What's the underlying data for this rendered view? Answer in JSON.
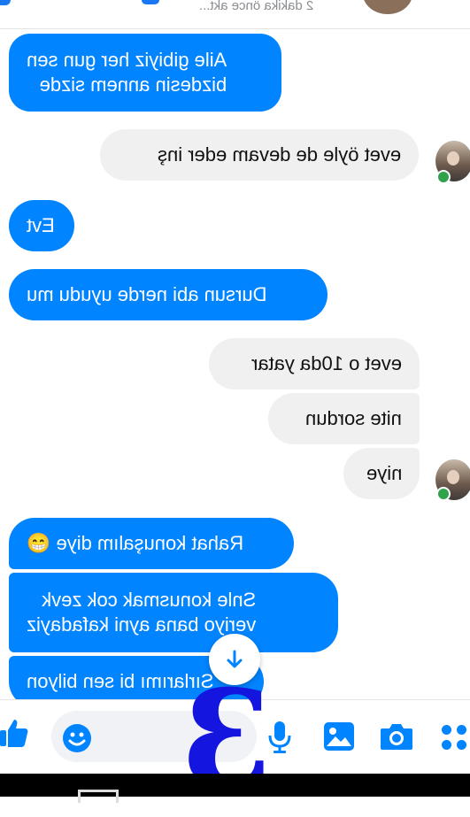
{
  "header": {
    "status_text": "2 dakika önce akt...",
    "colors": {
      "accent": "#1877f2"
    }
  },
  "messages": [
    {
      "side": "received",
      "text": "Aile gibiyiz her gun sen\nbizdesin annem sizde"
    },
    {
      "side": "sent",
      "text": "evet öyle de devam eder inş"
    },
    {
      "side": "received",
      "text": "Evt"
    },
    {
      "side": "received",
      "text": "Dursun abi nerde uyudu mu"
    },
    {
      "side": "sent",
      "text": "evet o 10da yatar"
    },
    {
      "side": "sent",
      "text": "nite sordun"
    },
    {
      "side": "sent",
      "text": "niye"
    },
    {
      "side": "received",
      "text": "Rahat konuşalım diye 😁"
    },
    {
      "side": "received",
      "text": "Snle konusmak cok zevk\nveriyo bana ayni kafadayiz"
    },
    {
      "side": "received",
      "text": "Sırlarımı bi sen bilyon"
    }
  ],
  "composer": {
    "icons": [
      "like-icon",
      "emoji-icon",
      "mic-icon",
      "gallery-icon",
      "camera-icon",
      "more-apps-icon"
    ]
  },
  "overlay": {
    "glyph": "3",
    "color": "#1515e0"
  },
  "colors": {
    "received_bubble": "#0084ff",
    "sent_bubble": "#f0f0f0",
    "online": "#31a24c"
  }
}
